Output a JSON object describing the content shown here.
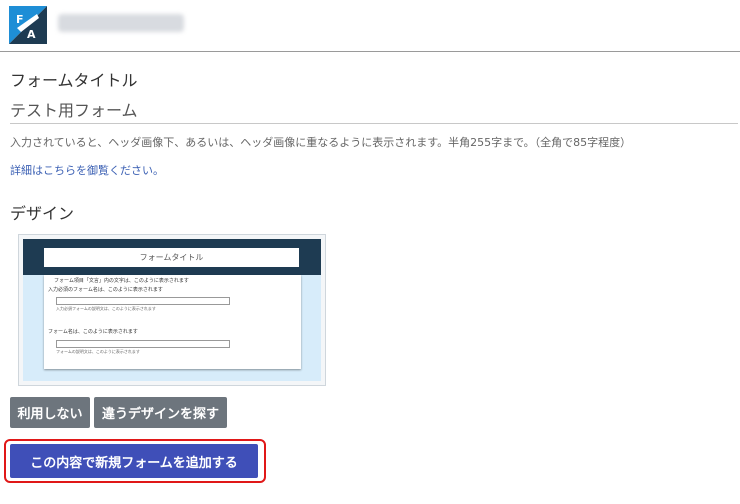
{
  "header": {
    "user_label": ""
  },
  "form_title": {
    "label": "フォームタイトル",
    "value": "テスト用フォーム",
    "description": "入力されていると、ヘッダ画像下、あるいは、ヘッダ画像に重なるように表示されます。半角255字まで。（全角で85字程度）",
    "link": "詳細はこちらを御覧ください。"
  },
  "design": {
    "label": "デザイン",
    "preview": {
      "title": "フォームタイトル",
      "line1": "フォーム項目「文言」内の文字は、このように表示されます",
      "required_label": "入力必須のフォーム名は、このように表示されます",
      "required_help": "入力必須フォームの説明文は、このように表示されます",
      "field_label": "フォーム名は、このように表示されます",
      "field_help": "フォームの説明文は、このように表示されます"
    }
  },
  "buttons": {
    "no_use": "利用しない",
    "other_design": "違うデザインを探す",
    "add_form": "この内容で新規フォームを追加する"
  },
  "colors": {
    "primary": "#3f4fb8",
    "secondary": "#6d757d",
    "highlight": "#e01818",
    "logo_blue": "#1e8ed6",
    "logo_navy": "#1e3b52"
  }
}
